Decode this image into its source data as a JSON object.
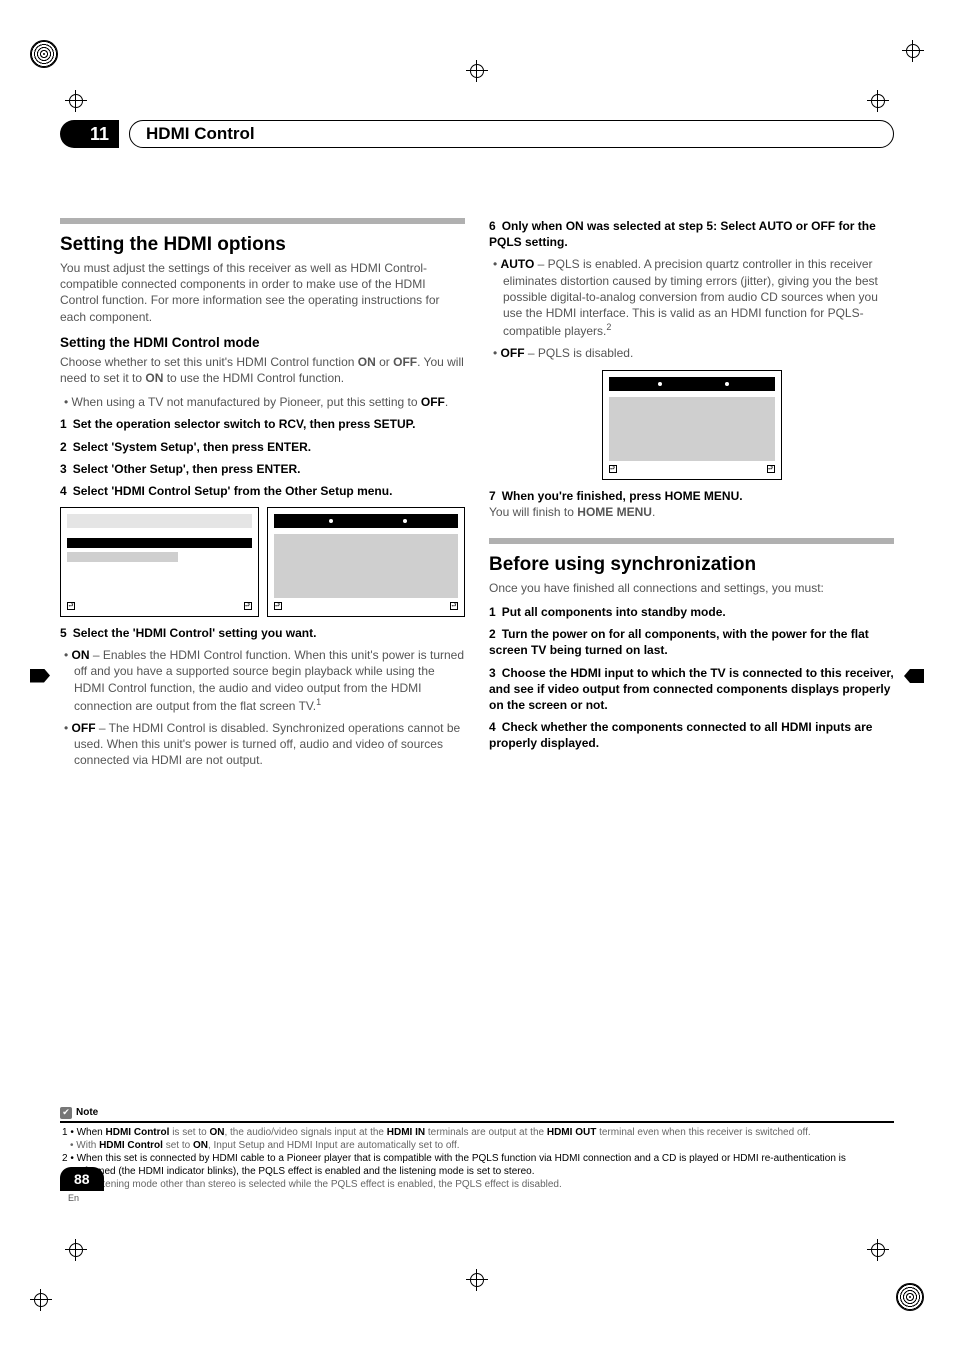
{
  "chapter": {
    "number": "11",
    "title": "HDMI Control"
  },
  "left": {
    "h2": "Setting the HDMI options",
    "intro": "You must adjust the settings of this receiver as well as HDMI Control-compatible connected components in order to make use of the HDMI Control function. For more information see the operating instructions for each component.",
    "h3": "Setting the HDMI Control mode",
    "h3_body": "Choose whether to set this unit's HDMI Control function ",
    "h3_body_on": "ON",
    "h3_body_or": " or ",
    "h3_body_off": "OFF",
    "h3_body2": ". You will need to set it to ",
    "h3_body_on2": "ON",
    "h3_body3": " to use the HDMI Control function.",
    "bullet_tv1": "When using a TV not manufactured by Pioneer, put this setting to ",
    "bullet_tv_off": "OFF",
    "bullet_tv2": ".",
    "step1": "Set the operation selector switch to RCV, then press SETUP.",
    "step2": "Select 'System Setup', then press ENTER.",
    "step3": "Select 'Other Setup', then press ENTER.",
    "step4": "Select 'HDMI Control Setup' from the Other Setup menu.",
    "step5": "Select the 'HDMI Control' setting you want.",
    "on_label": "ON",
    "on_text": " – Enables the HDMI Control function. When this unit's power is turned off and you have a supported source begin playback while using the HDMI Control function, the audio and video output from the HDMI connection are output from the flat screen TV.",
    "off_label": "OFF",
    "off_text": " – The HDMI Control is disabled. Synchronized operations cannot be used. When this unit's power is turned off, audio and video of sources connected via HDMI are not output."
  },
  "right": {
    "step6": "Only when ON was selected at step 5: Select AUTO or OFF for the PQLS setting.",
    "auto_label": "AUTO",
    "auto_text": " – PQLS is enabled. A precision quartz controller in this receiver eliminates distortion caused by timing errors (jitter), giving you the best possible digital-to-analog conversion from audio CD sources when you use the HDMI interface. This is valid as an HDMI function for PQLS-compatible players.",
    "off_label": "OFF",
    "off_text": " – PQLS is disabled.",
    "step7": "When you're finished, press HOME MENU.",
    "step7_extra_a": "You will finish to ",
    "step7_extra_b": "HOME MENU",
    "step7_extra_c": ".",
    "h2b": "Before using synchronization",
    "h2b_intro": "Once you have finished all connections and settings, you must:",
    "b1": "Put all components into standby mode.",
    "b2": "Turn the power on for all components, with the power for the flat screen TV being turned on last.",
    "b3": "Choose the HDMI input to which the TV is connected to this receiver, and see if video output from connected components displays properly on the screen or not.",
    "b4": "Check whether the components connected to all HDMI inputs are properly displayed."
  },
  "notes": {
    "label": "Note",
    "n1a": "1 • When ",
    "n1b": "HDMI Control",
    "n1c": " is set to ",
    "n1d": "ON",
    "n1e": ", the audio/video signals input at the ",
    "n1f": "HDMI IN",
    "n1g": " terminals are output at the ",
    "n1h": "HDMI OUT",
    "n1i": " terminal even when this receiver is switched off.",
    "n1_2a": "• With ",
    "n1_2b": "HDMI Control",
    "n1_2c": " set to ",
    "n1_2d": "ON",
    "n1_2e": ", Input Setup and HDMI Input are automatically set to off.",
    "n2a": "2 • When this set is connected by HDMI cable to a Pioneer player that is compatible with the PQLS function via HDMI connection and a CD is played or HDMI re-authentication is performed (the HDMI indicator blinks), the PQLS effect is enabled and the listening mode is set to stereo.",
    "n2b": "• If a listening mode other than stereo is selected while the PQLS effect is enabled, the PQLS effect is disabled."
  },
  "page": {
    "number": "88",
    "lang": "En"
  }
}
